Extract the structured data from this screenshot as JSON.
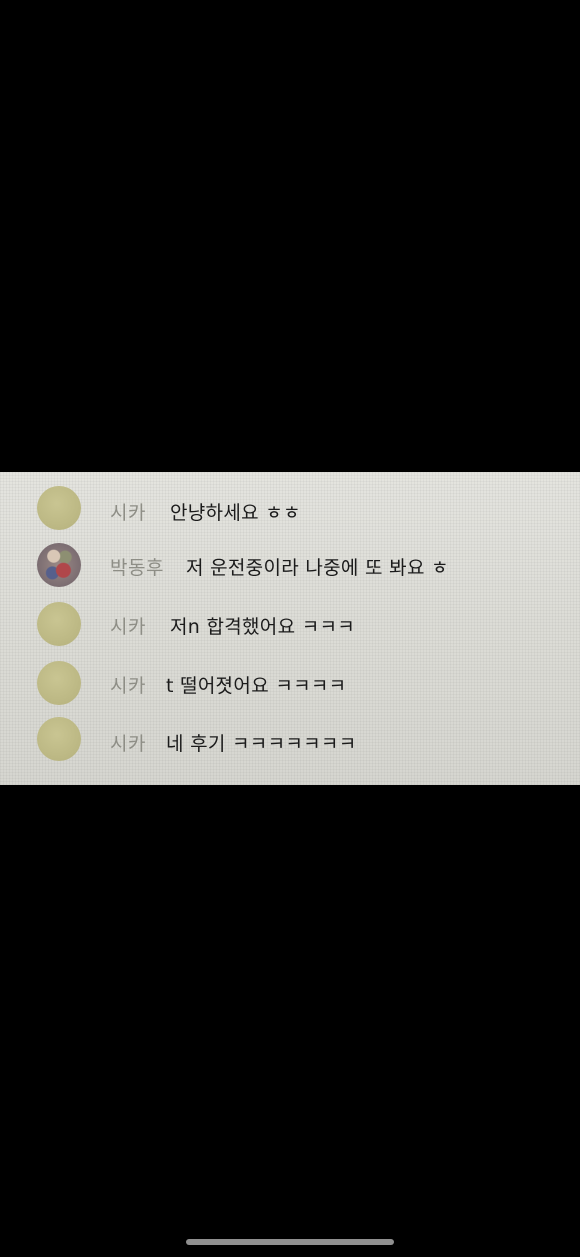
{
  "chat": {
    "messages": [
      {
        "sender": "시카",
        "text": "안냥하세요 ㅎㅎ",
        "avatar": "plain-avatar"
      },
      {
        "sender": "박동후",
        "text": "저 운전중이라 나중에 또 봐요 ㅎ",
        "avatar": "photo-avatar"
      },
      {
        "sender": "시카",
        "text": "저n 합격했어요 ㅋㅋㅋ",
        "avatar": "plain-avatar"
      },
      {
        "sender": "시카",
        "text": "t 떨어졋어요 ㅋㅋㅋㅋ",
        "avatar": "plain-avatar"
      },
      {
        "sender": "시카",
        "text": "네 후기 ㅋㅋㅋㅋㅋㅋㅋ",
        "avatar": "plain-avatar"
      }
    ]
  },
  "colors": {
    "background": "#000000",
    "photo_background": "#dcdcd6",
    "name_text": "#8e8e86",
    "message_text": "#1b1b1b",
    "avatar_plain": "#bdb985",
    "home_indicator": "#8f8f8f"
  }
}
